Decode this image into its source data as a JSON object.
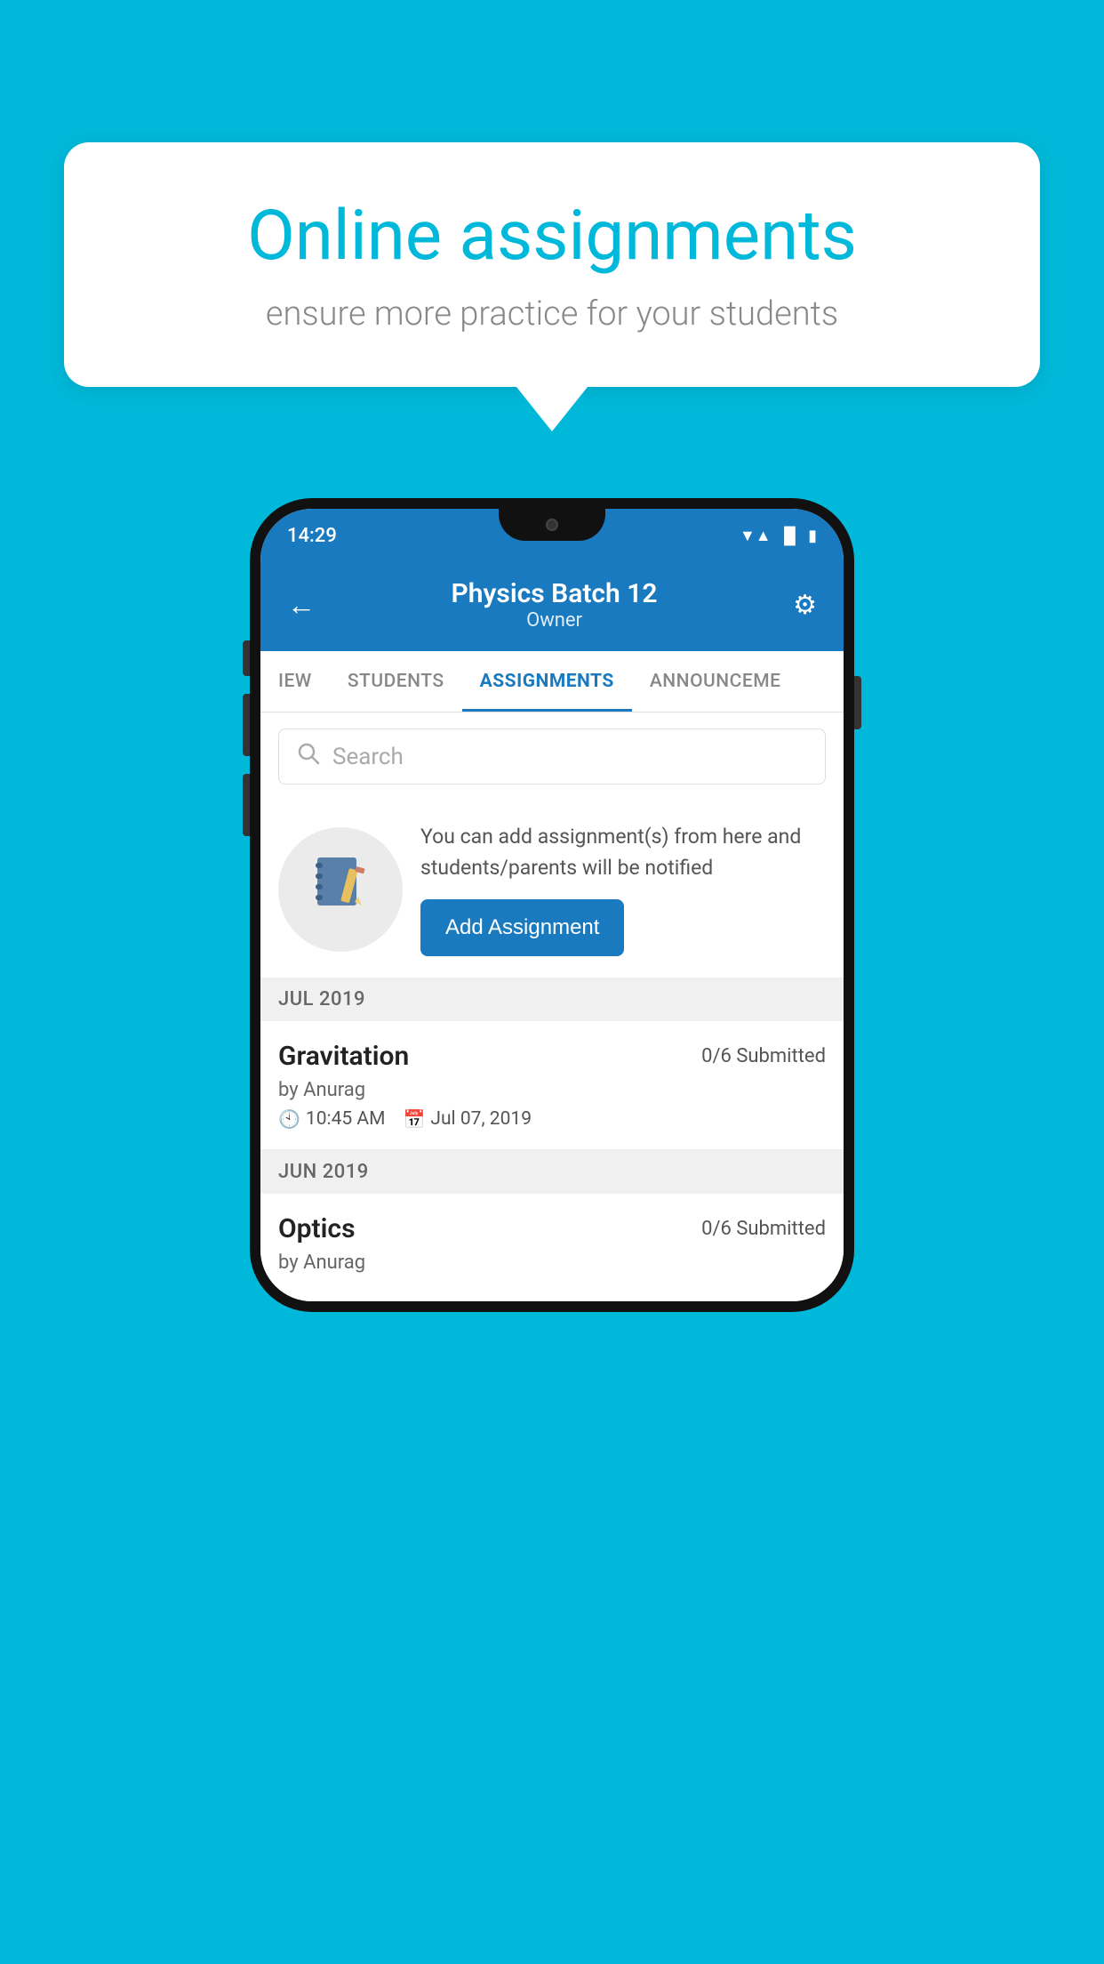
{
  "background_color": "#00B8D9",
  "speech_bubble": {
    "title": "Online assignments",
    "subtitle": "ensure more practice for your students"
  },
  "phone": {
    "status_bar": {
      "time": "14:29",
      "icons": [
        "wifi",
        "signal",
        "battery"
      ]
    },
    "header": {
      "title": "Physics Batch 12",
      "subtitle": "Owner",
      "back_label": "←",
      "settings_label": "⚙"
    },
    "tabs": [
      {
        "label": "IEW",
        "active": false
      },
      {
        "label": "STUDENTS",
        "active": false
      },
      {
        "label": "ASSIGNMENTS",
        "active": true
      },
      {
        "label": "ANNOUNCEME",
        "active": false
      }
    ],
    "search": {
      "placeholder": "Search"
    },
    "promo": {
      "text": "You can add assignment(s) from here and students/parents will be notified",
      "button_label": "Add Assignment"
    },
    "assignments": [
      {
        "month_label": "JUL 2019",
        "items": [
          {
            "title": "Gravitation",
            "submitted": "0/6 Submitted",
            "by": "by Anurag",
            "time": "10:45 AM",
            "date": "Jul 07, 2019"
          }
        ]
      },
      {
        "month_label": "JUN 2019",
        "items": [
          {
            "title": "Optics",
            "submitted": "0/6 Submitted",
            "by": "by Anurag",
            "time": "",
            "date": ""
          }
        ]
      }
    ]
  }
}
